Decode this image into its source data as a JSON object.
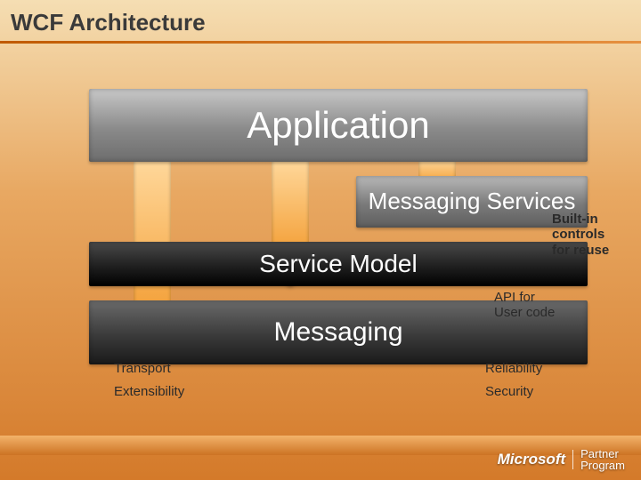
{
  "title": "WCF Architecture",
  "layers": {
    "application": "Application",
    "messaging_services": "Messaging\nServices",
    "service_model": "Service Model",
    "messaging": "Messaging"
  },
  "annotations": {
    "builtin": "Built-in controls for reuse",
    "api": "API for\nUser code"
  },
  "messaging_items_left": [
    "Transport",
    "Extensibility"
  ],
  "messaging_items_right": [
    "Reliability",
    "Security"
  ],
  "footer": {
    "brand": "Microsoft",
    "program_l1": "Partner",
    "program_l2": "Program"
  }
}
